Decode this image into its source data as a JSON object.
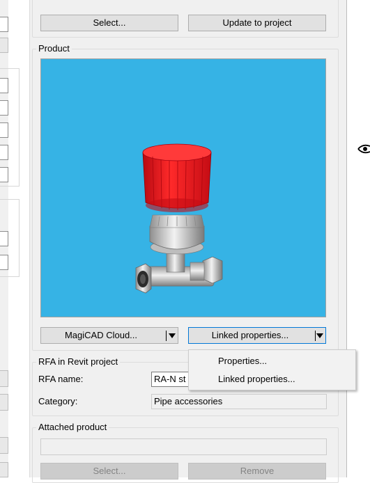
{
  "product_selection": {
    "select_label": "Select...",
    "update_label": "Update to project"
  },
  "product": {
    "title": "Product",
    "preview_bg": "#36b3e5",
    "cloud_label": "MagiCAD Cloud...",
    "linked_label": "Linked properties..."
  },
  "dropdown_menu": {
    "items": [
      "Properties...",
      "Linked properties..."
    ]
  },
  "rfa": {
    "title": "RFA in Revit project",
    "name_label": "RFA name:",
    "name_value": "RA-N st",
    "category_label": "Category:",
    "category_value": "Pipe accessories"
  },
  "attached": {
    "title": "Attached product",
    "value": "",
    "select_label": "Select...",
    "remove_label": "Remove"
  },
  "colors": {
    "panel": "#f0f0f0",
    "accent": "#0078d7",
    "valve_cap": "#e8101b"
  }
}
